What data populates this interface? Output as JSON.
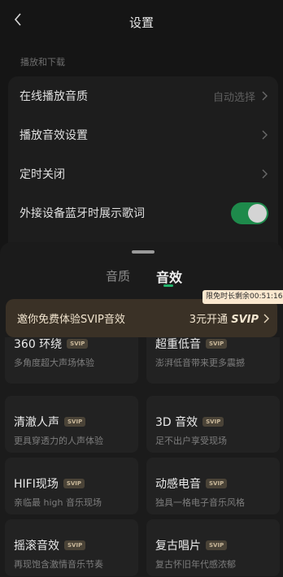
{
  "header": {
    "title": "设置"
  },
  "section_title": "播放和下载",
  "settings": {
    "quality_label": "在线播放音质",
    "quality_value": "自动选择",
    "effect_label": "播放音效设置",
    "timer_label": "定时关闭",
    "lyrics_label": "外接设备蓝牙时展示歌词",
    "lyrics_toggle_on": true
  },
  "sheet": {
    "tabs": [
      "音质",
      "音效"
    ],
    "active_tab": "音效",
    "timer_badge": "限免时长剩余00:51:16",
    "banner_text": "邀你免费体验SVIP音效",
    "banner_action_prefix": "3元开通",
    "banner_action_brand": "SVIP"
  },
  "effects": [
    {
      "name": "360 环绕",
      "badge": "SVIP",
      "desc": "多角度超大声场体验"
    },
    {
      "name": "超重低音",
      "badge": "SVIP",
      "desc": "澎湃低音带来更多震撼"
    },
    {
      "name": "清澈人声",
      "badge": "SVIP",
      "desc": "更具穿透力的人声体验"
    },
    {
      "name": "3D 音效",
      "badge": "SVIP",
      "desc": "足不出户享受现场"
    },
    {
      "name": "HIFI现场",
      "badge": "SVIP",
      "desc": "亲临最 high 音乐现场"
    },
    {
      "name": "动感电音",
      "badge": "SVIP",
      "desc": "独具一格电子音乐风格"
    },
    {
      "name": "摇滚音效",
      "badge": "SVIP",
      "desc": "再现饱含激情音乐节奏"
    },
    {
      "name": "复古唱片",
      "badge": "SVIP",
      "desc": "复古怀旧年代感浓郁"
    }
  ],
  "colors": {
    "accent": "#21b36a",
    "toggle_on": "#1e8a4b",
    "banner_bg": "#3a3126"
  }
}
